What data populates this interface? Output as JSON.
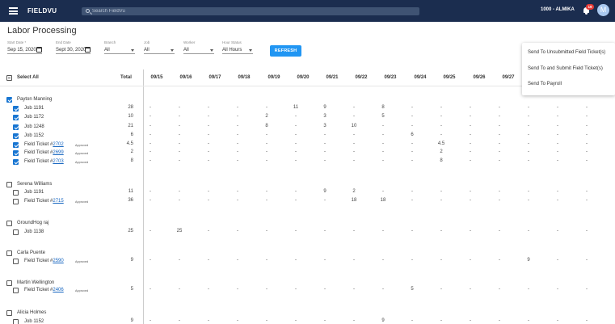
{
  "topbar": {
    "brand": "FIELDVU",
    "search_placeholder": "Search FieldVu",
    "company": "1000 - ALMIKA",
    "notifications": "19",
    "avatar_letter": "M"
  },
  "page_title": "Labor Processing",
  "filters": {
    "start_date": {
      "label": "Start Date *",
      "value": "Sep 15, 2020"
    },
    "end_date": {
      "label": "End Date",
      "value": "Sept 30, 2020"
    },
    "branch": {
      "label": "Branch",
      "value": "All"
    },
    "job": {
      "label": "Job",
      "value": "All"
    },
    "worker": {
      "label": "Worker",
      "value": "All"
    },
    "hour_status": {
      "label": "Hour Status",
      "value": "All Hours"
    },
    "refresh_label": "REFRESH"
  },
  "grid": {
    "select_all": "Select All",
    "total_header": "Total",
    "dates": [
      "09/15",
      "09/16",
      "09/17",
      "09/18",
      "09/19",
      "09/20",
      "09/21",
      "09/22",
      "09/23",
      "09/24",
      "09/25",
      "09/26",
      "09/27"
    ],
    "approved_label": "Approved",
    "ticket_prefix": "Field Ticket #",
    "rows": [
      {
        "kind": "worker",
        "label": "Payton Manning",
        "checked": true
      },
      {
        "kind": "item",
        "label": "Job 1191",
        "checked": true,
        "total": "28",
        "cells": [
          "-",
          "-",
          "-",
          "-",
          "-",
          "11",
          "9",
          "-",
          "8",
          "-",
          "-",
          "-",
          "-",
          "-",
          "-",
          "-"
        ]
      },
      {
        "kind": "item",
        "label": "Job 1172",
        "checked": true,
        "total": "10",
        "cells": [
          "-",
          "-",
          "-",
          "-",
          "2",
          "-",
          "3",
          "-",
          "5",
          "-",
          "-",
          "-",
          "-",
          "-",
          "-",
          "-"
        ]
      },
      {
        "kind": "item",
        "label": "Job 1248",
        "checked": true,
        "total": "21",
        "cells": [
          "-",
          "-",
          "-",
          "-",
          "8",
          "-",
          "3",
          "10",
          "-",
          "-",
          "-",
          "-",
          "-",
          "-",
          "-",
          "-"
        ]
      },
      {
        "kind": "item",
        "label": "Job 1152",
        "checked": true,
        "total": "6",
        "cells": [
          "-",
          "-",
          "-",
          "-",
          "-",
          "-",
          "-",
          "-",
          "-",
          "6",
          "-",
          "-",
          "-",
          "-",
          "-",
          "-"
        ]
      },
      {
        "kind": "ticket",
        "ticket": "2702",
        "checked": true,
        "total": "4.5",
        "cells": [
          "-",
          "-",
          "-",
          "-",
          "-",
          "-",
          "-",
          "-",
          "-",
          "-",
          "4.5",
          "-",
          "-",
          "-",
          "-",
          "-"
        ]
      },
      {
        "kind": "ticket",
        "ticket": "2699",
        "checked": true,
        "total": "2",
        "cells": [
          "-",
          "-",
          "-",
          "-",
          "-",
          "-",
          "-",
          "-",
          "-",
          "-",
          "2",
          "-",
          "-",
          "-",
          "-",
          "-"
        ]
      },
      {
        "kind": "ticket",
        "ticket": "2703",
        "checked": true,
        "total": "8",
        "cells": [
          "-",
          "-",
          "-",
          "-",
          "-",
          "-",
          "-",
          "-",
          "-",
          "-",
          "8",
          "-",
          "-",
          "-",
          "-",
          "-"
        ]
      },
      {
        "kind": "worker",
        "label": "Serena Williams",
        "checked": false
      },
      {
        "kind": "item",
        "label": "Job 1191",
        "checked": false,
        "total": "11",
        "cells": [
          "-",
          "-",
          "-",
          "-",
          "-",
          "-",
          "9",
          "2",
          "-",
          "-",
          "-",
          "-",
          "-",
          "-",
          "-",
          "-"
        ]
      },
      {
        "kind": "ticket",
        "ticket": "2715",
        "checked": false,
        "total": "36",
        "cells": [
          "-",
          "-",
          "-",
          "-",
          "-",
          "-",
          "-",
          "18",
          "18",
          "-",
          "-",
          "-",
          "-",
          "-",
          "-",
          "-"
        ]
      },
      {
        "kind": "worker",
        "label": "GroundHog raj",
        "checked": false
      },
      {
        "kind": "item",
        "label": "Job 1138",
        "checked": false,
        "total": "25",
        "cells": [
          "-",
          "25",
          "-",
          "-",
          "-",
          "-",
          "-",
          "-",
          "-",
          "-",
          "-",
          "-",
          "-",
          "-",
          "-",
          "-"
        ]
      },
      {
        "kind": "worker",
        "label": "Carla Puente",
        "checked": false
      },
      {
        "kind": "ticket",
        "ticket": "2590",
        "checked": false,
        "total": "9",
        "cells": [
          "-",
          "-",
          "-",
          "-",
          "-",
          "-",
          "-",
          "-",
          "-",
          "-",
          "-",
          "-",
          "-",
          "9",
          "-",
          "-"
        ]
      },
      {
        "kind": "worker",
        "label": "Martin Wellington",
        "checked": false
      },
      {
        "kind": "ticket",
        "ticket": "2406",
        "checked": false,
        "total": "5",
        "cells": [
          "-",
          "-",
          "-",
          "-",
          "-",
          "-",
          "-",
          "-",
          "-",
          "5",
          "-",
          "-",
          "-",
          "-",
          "-",
          "-"
        ]
      },
      {
        "kind": "worker",
        "label": "Alicia Holmes",
        "checked": false
      },
      {
        "kind": "item",
        "label": "Job 1152",
        "checked": false,
        "total": "9",
        "cells": [
          "-",
          "-",
          "-",
          "-",
          "-",
          "-",
          "-",
          "-",
          "9",
          "-",
          "-",
          "-",
          "-",
          "-",
          "-",
          "-"
        ]
      }
    ]
  },
  "actions_menu": [
    "Send To Unsubmitted Field Ticket(s)",
    "Send To and Submit Field Ticket(s)",
    "Send To Payroll"
  ]
}
